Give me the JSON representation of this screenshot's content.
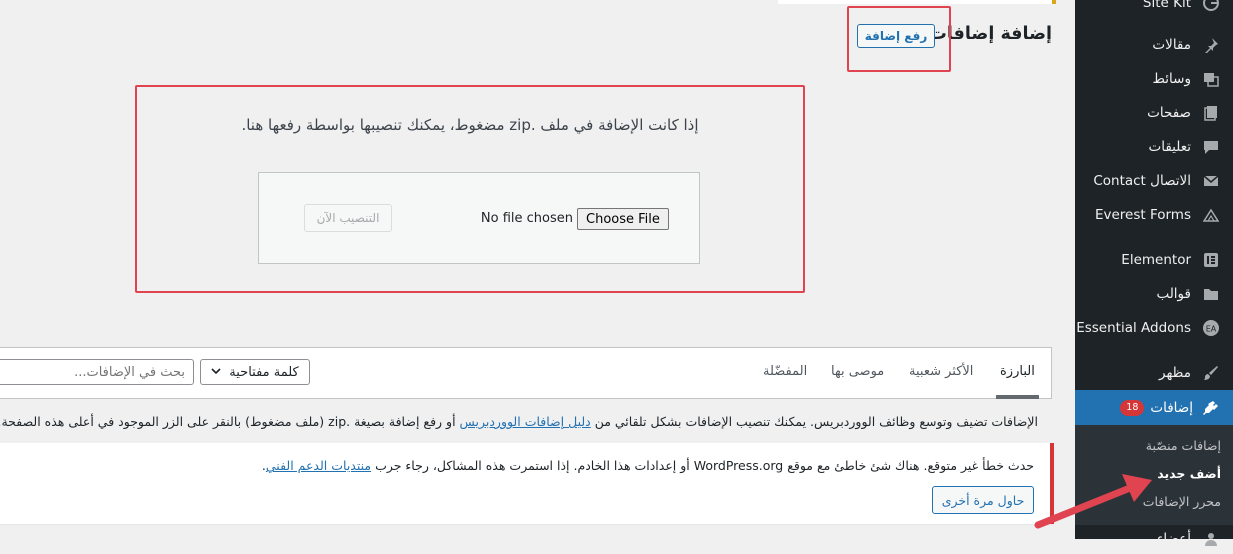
{
  "sidebar": {
    "items": [
      {
        "label": "Site Kit",
        "icon": "google-g-icon"
      },
      {
        "label": "مقالات",
        "icon": "pin-icon"
      },
      {
        "label": "وسائط",
        "icon": "media-icon"
      },
      {
        "label": "صفحات",
        "icon": "pages-icon"
      },
      {
        "label": "تعليقات",
        "icon": "comment-icon"
      },
      {
        "label": "Contact الاتصال",
        "icon": "mail-icon"
      },
      {
        "label": "Everest Forms",
        "icon": "everest-icon"
      },
      {
        "label": "Elementor",
        "icon": "elementor-icon"
      },
      {
        "label": "قوالب",
        "icon": "folder-icon"
      },
      {
        "label": "Essential Addons",
        "icon": "ea-icon"
      },
      {
        "label": "مظهر",
        "icon": "brush-icon"
      },
      {
        "label": "إضافات",
        "icon": "plugin-icon",
        "badge": "18",
        "current": true
      }
    ],
    "submenu": [
      {
        "label": "إضافات منصّبة"
      },
      {
        "label": "أضف جديد",
        "active": true
      },
      {
        "label": "محرر الإضافات"
      }
    ],
    "cut_item": "أعضاء"
  },
  "header": {
    "title": "إضافة إضافات",
    "upload_button": "رفع إضافة"
  },
  "upload": {
    "help_text": "إذا كانت الإضافة في ملف .zip مضغوط، يمكنك تنصيبها بواسطة رفعها هنا.",
    "choose_file": "Choose File",
    "no_file": "No file chosen",
    "install_now": "التنصيب الآن"
  },
  "filter": {
    "tabs": [
      {
        "label": "البارزة",
        "current": true
      },
      {
        "label": "الأكثر شعبية"
      },
      {
        "label": "موصى بها"
      },
      {
        "label": "المفضّلة"
      }
    ],
    "search_type": "كلمة مفتاحية",
    "search_placeholder": "بحث في الإضافات..."
  },
  "intro": {
    "before": "الإضافات تضيف وتوسع وظائف الووردبريس. يمكنك تنصيب الإضافات بشكل تلقائي من ",
    "link": "دليل إضافات الووردبريس",
    "after": " أو رفع إضافة بصيغة .zip (ملف مضغوط) بالنقر على الزر الموجود في أعلى هذه الصفحة."
  },
  "error": {
    "before": "حدث خطأ غير متوقع. هناك شئ خاطئ مع موقع WordPress.org أو إعدادات هذا الخادم. إذا استمرت هذه المشاكل، رجاء جرب ",
    "link": "منتديات الدعم الفني",
    "after": ".",
    "retry": "حاول مرة أخرى"
  },
  "colors": {
    "sidebar_bg": "#1d2327",
    "accent": "#2271b1",
    "error": "#d63638",
    "highlight": "#e04450"
  }
}
